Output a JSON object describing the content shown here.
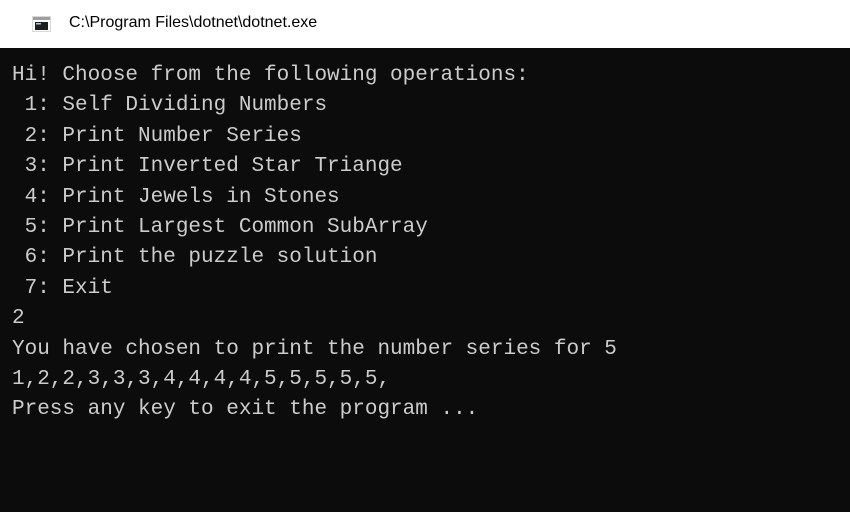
{
  "window": {
    "title": "C:\\Program Files\\dotnet\\dotnet.exe",
    "icon": "console-app-icon",
    "colors": {
      "console_background": "#0c0c0c",
      "console_text": "#cccccc",
      "titlebar_background": "#ffffff"
    }
  },
  "console": {
    "lines": [
      "Hi! Choose from the following operations:",
      " 1: Self Dividing Numbers",
      " 2: Print Number Series",
      " 3: Print Inverted Star Triange",
      " 4: Print Jewels in Stones",
      " 5: Print Largest Common SubArray",
      " 6: Print the puzzle solution",
      " 7: Exit",
      "2",
      "You have chosen to print the number series for 5",
      "1,2,2,3,3,3,4,4,4,4,5,5,5,5,5,",
      "Press any key to exit the program ..."
    ]
  }
}
